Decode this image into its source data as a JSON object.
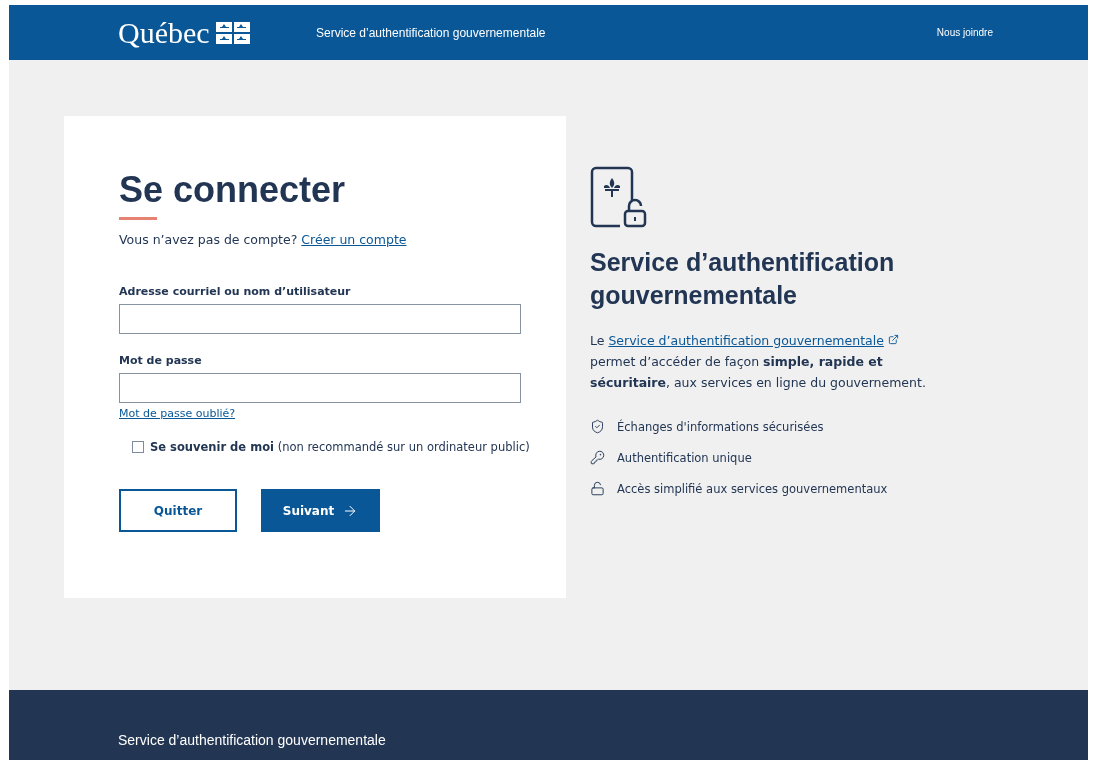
{
  "header": {
    "logo": "Québec",
    "title": "Service d’authentification gouvernementale",
    "link": "Nous joindre"
  },
  "login": {
    "title": "Se connecter",
    "prompt": "Vous n’avez pas de compte?",
    "create_link": "Créer un compte",
    "fields": [
      {
        "label": "Adresse courriel ou nom d’utilisateur"
      },
      {
        "label": "Mot de passe"
      }
    ],
    "forgot_link": "Mot de passe oublié?",
    "remember": {
      "label": "**Se souvenir de moi** (non recommandé sur un ordinateur public)",
      "checked": false
    },
    "buttons": [
      {
        "label": "Quitter",
        "kind": "secondary"
      },
      {
        "label": "Suivant",
        "kind": "primary"
      }
    ]
  },
  "info": {
    "title": "Service d’authentification gouvernementale",
    "intro": "Le",
    "link": "Service d’authentification gouvernementale",
    "body": "permet d’accéder de façon **simple, rapide et sécuritaire**, aux services en ligne du gouvernement.",
    "features": [
      {
        "kind": "shield",
        "text": "Échanges d'informations sécurisées"
      },
      {
        "kind": "key",
        "text": "Authentification unique"
      },
      {
        "kind": "lock",
        "text": "Accès simplifié aux services gouvernementaux"
      }
    ]
  },
  "footer": {
    "title": "Service d’authentification gouvernementale"
  }
}
